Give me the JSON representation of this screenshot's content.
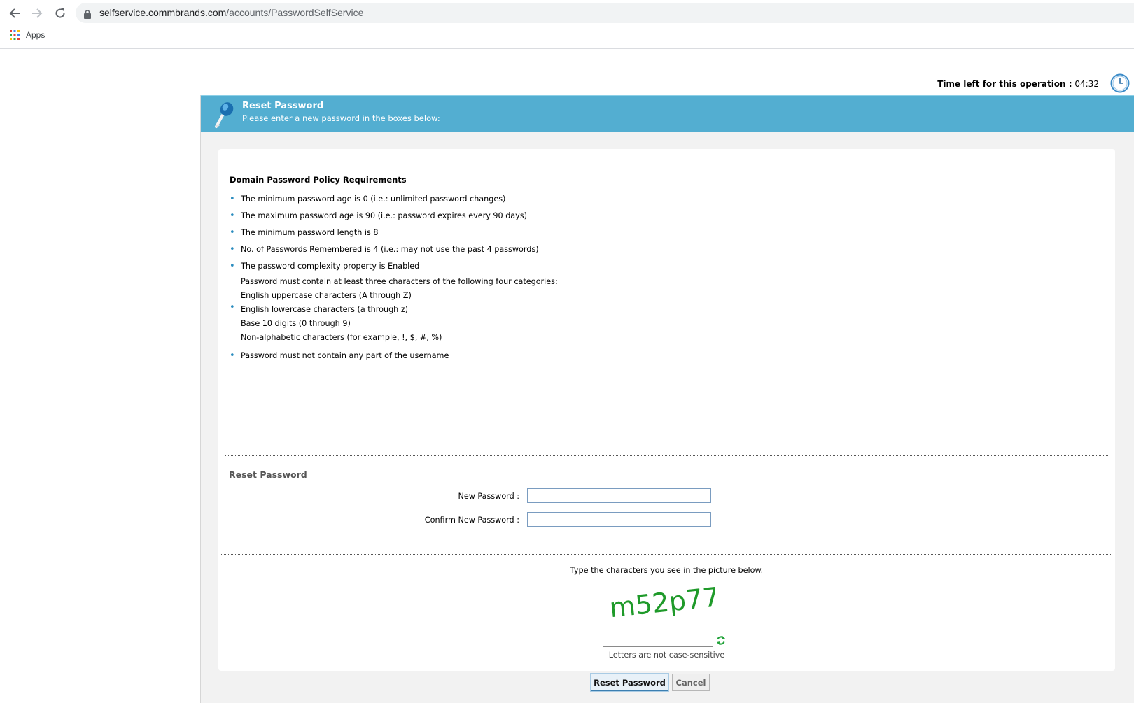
{
  "browser": {
    "url_domain": "selfservice.commbrands.com",
    "url_path": "/accounts/PasswordSelfService",
    "bookmarks": {
      "apps_label": "Apps"
    }
  },
  "timer": {
    "label": "Time left for this operation :",
    "value": "04:32"
  },
  "header": {
    "title": "Reset Password",
    "subtitle": "Please enter a new password in the boxes below:"
  },
  "policy": {
    "title": "Domain Password Policy Requirements",
    "items": [
      "The minimum password age is 0 (i.e.: unlimited password changes)",
      "The maximum password age is 90 (i.e.: password expires every 90 days)",
      "The minimum password length is 8",
      "No. of Passwords Remembered is 4 (i.e.: may not use the past 4 passwords)",
      "The password complexity property is Enabled"
    ],
    "complexity_lines": [
      "Password must contain at least three characters of the following four categories:",
      "English uppercase characters (A through Z)",
      "English lowercase characters (a through z)",
      "Base 10 digits (0 through 9)",
      "Non-alphabetic characters (for example, !, $, #, %)"
    ],
    "last_item": "Password must not contain any part of the username"
  },
  "reset_form": {
    "section_title": "Reset Password",
    "new_password_label": "New Password :",
    "confirm_password_label": "Confirm New Password :",
    "new_password_value": "",
    "confirm_password_value": ""
  },
  "captcha": {
    "prompt": "Type the characters you see in the picture below.",
    "image_text": "m52p77",
    "input_value": "",
    "note": "Letters are not case-sensitive"
  },
  "buttons": {
    "reset_label": "Reset Password",
    "cancel_label": "Cancel"
  },
  "colors": {
    "header_bg": "#53aed1",
    "bullet": "#2c8dbf",
    "captcha_text": "#1f9a2a"
  }
}
